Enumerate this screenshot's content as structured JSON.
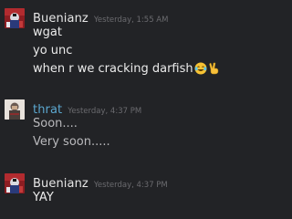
{
  "messages": [
    {
      "user": "Buenianz",
      "timestamp": "Yesterday, 1:55 AM",
      "avatar_icon": "buenianz-avatar-icon",
      "lines": [
        "wgat",
        "yo unc",
        "when r we cracking darfish"
      ],
      "emojis": [
        "laughing-tears-emoji-icon",
        "victory-hand-emoji-icon"
      ]
    },
    {
      "user": "thrat",
      "timestamp": "Yesterday, 4:37 PM",
      "avatar_icon": "thrat-avatar-icon",
      "lines": [
        "Soon....",
        "Very soon....."
      ]
    },
    {
      "user": "Buenianz",
      "timestamp": "Yesterday, 4:37 PM",
      "avatar_icon": "buenianz-avatar-icon",
      "lines": [
        "YAY"
      ]
    }
  ],
  "colors": {
    "background": "#222326",
    "self_name": "#e6e6e6",
    "friend_name": "#5ba7cf",
    "timestamp": "#6b6b6f",
    "text": "#ebebeb",
    "text_dim": "#b9b9bc"
  }
}
